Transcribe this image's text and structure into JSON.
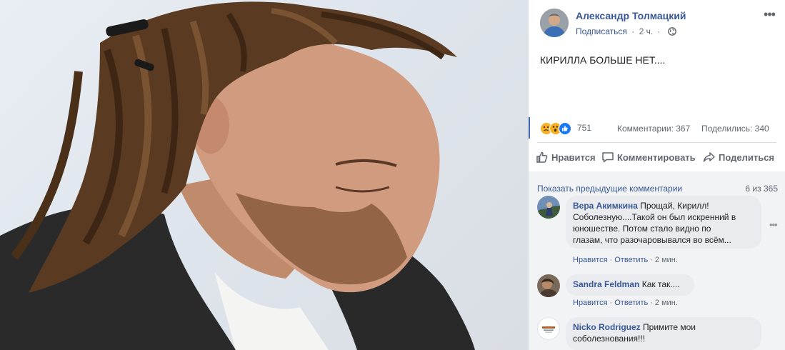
{
  "photo": {
    "alt": ""
  },
  "post": {
    "author": "Александр Толмацкий",
    "subscribe_label": "Подписаться",
    "separator": "·",
    "time": "2 ч.",
    "text": "КИРИЛЛА БОЛЬШЕ НЕТ...."
  },
  "stats": {
    "reactions_count": "751",
    "comments": "Комментарии: 367",
    "shares": "Поделились: 340",
    "reaction_types": [
      "sad",
      "wow",
      "like"
    ]
  },
  "actions": {
    "like_label": "Нравится",
    "comment_label": "Комментировать",
    "share_label": "Поделиться"
  },
  "comments_section": {
    "show_previous_label": "Показать предыдущие комментарии",
    "count_label": "6 из 365",
    "comments": [
      {
        "author": "Вера Акимкина",
        "lines": [
          "Прощай, Кирилл!",
          "Соболезную....Такой он был искренний в",
          "юношестве. Потом стало видно по",
          "глазам, что разочаровывался во всём..."
        ],
        "like_label": "Нравится",
        "reply_label": "Ответить",
        "time": "2 мин."
      },
      {
        "author": "Sandra Feldman",
        "text": "Как так....",
        "like_label": "Нравится",
        "reply_label": "Ответить",
        "time": "2 мин."
      },
      {
        "author": "Nicko Rodriguez",
        "text_line1": "Примите мои",
        "text_line2": "соболезнования!!!"
      }
    ]
  },
  "colors": {
    "link": "#385898",
    "muted": "#606770",
    "bubble": "#e9ebee",
    "comments_bg": "#f2f3f5",
    "accent": "#4267b2"
  },
  "icons": [
    "globe-icon",
    "more-options-icon",
    "like-icon",
    "comment-icon",
    "share-icon",
    "sad-reaction-icon",
    "wow-reaction-icon",
    "like-reaction-icon"
  ]
}
